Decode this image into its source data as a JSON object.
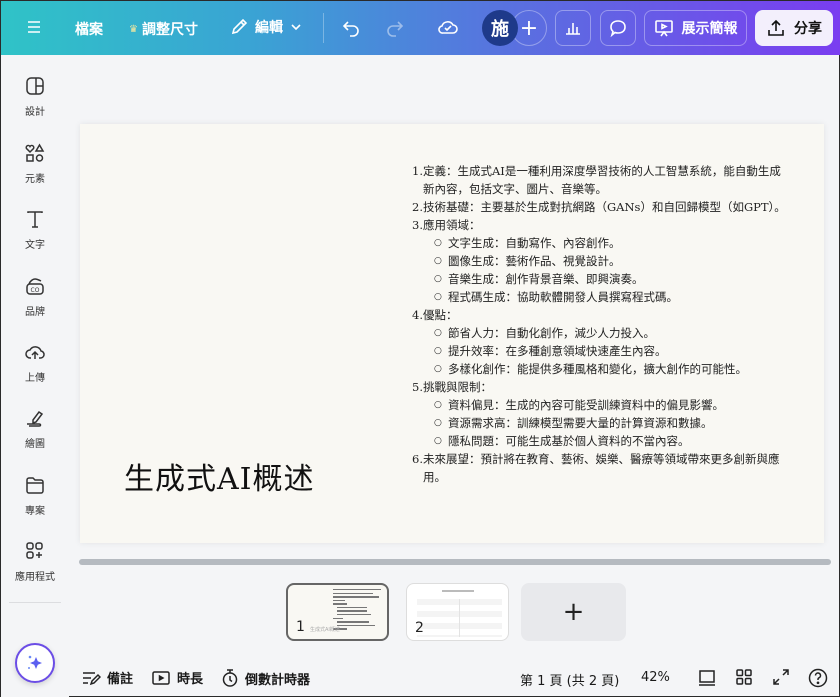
{
  "topbar": {
    "menu_icon": "hamburger-menu-icon",
    "file_label": "檔案",
    "resize_label": "調整尺寸",
    "resize_icon": "crown-icon",
    "edit_label": "編輯",
    "edit_icon": "pencil-icon",
    "undo_icon": "undo-icon",
    "redo_icon": "redo-icon",
    "cloud_icon": "cloud-check-icon",
    "avatar_initial": "施",
    "add_collaborator": "+",
    "insights_icon": "bar-chart-icon",
    "comment_icon": "comment-icon",
    "present_label": "展示簡報",
    "present_icon": "presentation-icon",
    "share_label": "分享",
    "share_icon": "upload-icon"
  },
  "sidebar": {
    "items": [
      {
        "label": "設計",
        "icon": "layout-icon"
      },
      {
        "label": "元素",
        "icon": "shapes-icon"
      },
      {
        "label": "文字",
        "icon": "text-icon"
      },
      {
        "label": "品牌",
        "icon": "brand-icon"
      },
      {
        "label": "上傳",
        "icon": "cloud-upload-icon"
      },
      {
        "label": "繪圖",
        "icon": "draw-icon"
      },
      {
        "label": "專案",
        "icon": "folder-icon"
      },
      {
        "label": "應用程式",
        "icon": "apps-icon"
      }
    ],
    "magic_icon": "sparkle-icon"
  },
  "slide": {
    "title": "生成式AI概述",
    "items": [
      {
        "type": "ol",
        "num": "1.",
        "text": "定義：生成式AI是一種利用深度學習技術的人工智慧系統，能自動生成新內容，包括文字、圖片、音樂等。"
      },
      {
        "type": "ol",
        "num": "2.",
        "text": "技術基礎：主要基於生成對抗網路（GANs）和自回歸模型（如GPT）。"
      },
      {
        "type": "ol",
        "num": "3.",
        "text": "應用領域："
      },
      {
        "type": "ul",
        "text": "文字生成：自動寫作、內容創作。"
      },
      {
        "type": "ul",
        "text": "圖像生成：藝術作品、視覺設計。"
      },
      {
        "type": "ul",
        "text": "音樂生成：創作背景音樂、即興演奏。"
      },
      {
        "type": "ul",
        "text": "程式碼生成：協助軟體開發人員撰寫程式碼。"
      },
      {
        "type": "ol",
        "num": "4.",
        "text": "優點："
      },
      {
        "type": "ul",
        "text": "節省人力：自動化創作，減少人力投入。"
      },
      {
        "type": "ul",
        "text": "提升效率：在多種創意領域快速產生內容。"
      },
      {
        "type": "ul",
        "text": "多樣化創作：能提供多種風格和變化，擴大創作的可能性。"
      },
      {
        "type": "ol",
        "num": "5.",
        "text": "挑戰與限制："
      },
      {
        "type": "ul",
        "text": "資料偏見：生成的內容可能受訓練資料中的偏見影響。"
      },
      {
        "type": "ul",
        "text": "資源需求高：訓練模型需要大量的計算資源和數據。"
      },
      {
        "type": "ul",
        "text": "隱私問題：可能生成基於個人資料的不當內容。"
      },
      {
        "type": "ol",
        "num": "6.",
        "text": "未來展望：預計將在教育、藝術、娛樂、醫療等領域帶來更多創新與應用。"
      }
    ],
    "bullet": "○"
  },
  "thumbnails": [
    {
      "num": "1",
      "active": true
    },
    {
      "num": "2",
      "active": false
    }
  ],
  "add_slide": "+",
  "bottombar": {
    "notes_label": "備註",
    "notes_icon": "notes-icon",
    "duration_label": "時長",
    "duration_icon": "play-box-icon",
    "timer_label": "倒數計時器",
    "timer_icon": "stopwatch-icon",
    "page_indicator": "第 1 頁 (共 2 頁)",
    "zoom_level": "42%",
    "view_single_icon": "single-view-icon",
    "grid_view_icon": "grid-view-icon",
    "fullscreen_icon": "expand-icon",
    "help_icon": "help-icon"
  }
}
